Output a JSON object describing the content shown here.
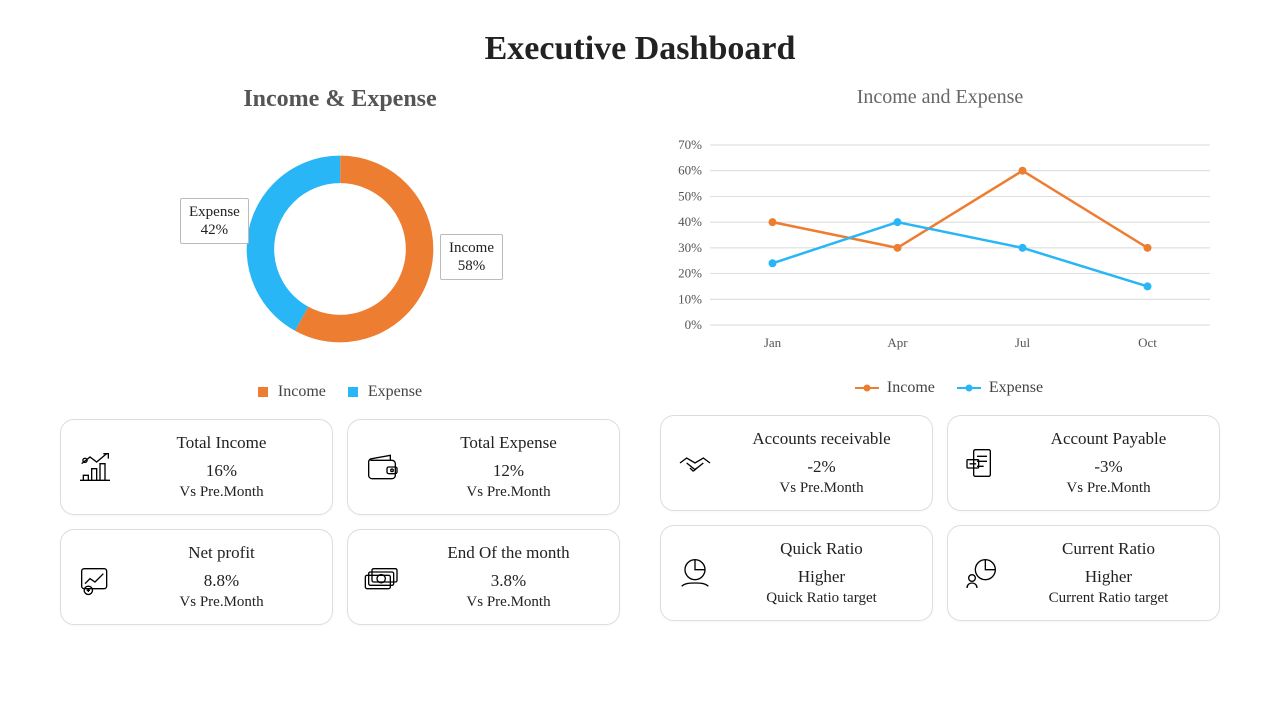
{
  "title": "Executive Dashboard",
  "colors": {
    "income": "#ED7D31",
    "expense": "#29B6F6"
  },
  "donut": {
    "title": "Income & Expense",
    "income_label_name": "Income",
    "income_label_pct": "58%",
    "expense_label_name": "Expense",
    "expense_label_pct": "42%",
    "legend_income": "Income",
    "legend_expense": "Expense"
  },
  "line": {
    "title": "Income and Expense",
    "legend_income": "Income",
    "legend_expense": "Expense"
  },
  "left_cards": [
    {
      "title": "Total Income",
      "value": "16%",
      "sub": "Vs Pre.Month",
      "icon": "money-growth"
    },
    {
      "title": "Total Expense",
      "value": "12%",
      "sub": "Vs Pre.Month",
      "icon": "wallet"
    },
    {
      "title": "Net profit",
      "value": "8.8%",
      "sub": "Vs Pre.Month",
      "icon": "profit-chart"
    },
    {
      "title": "End Of the month",
      "value": "3.8%",
      "sub": "Vs Pre.Month",
      "icon": "cash-stack"
    }
  ],
  "right_cards": [
    {
      "title": "Accounts receivable",
      "value": "-2%",
      "sub": "Vs Pre.Month",
      "icon": "handshake"
    },
    {
      "title": "Account Payable",
      "value": "-3%",
      "sub": "Vs Pre.Month",
      "icon": "receipt"
    },
    {
      "title": "Quick Ratio",
      "value": "Higher",
      "sub": "Quick Ratio target",
      "icon": "pie-hand"
    },
    {
      "title": "Current Ratio",
      "value": "Higher",
      "sub": "Current Ratio target",
      "icon": "pie-person"
    }
  ],
  "chart_data": [
    {
      "type": "pie",
      "title": "Income & Expense",
      "series": [
        {
          "name": "Income",
          "value": 58,
          "color": "#ED7D31"
        },
        {
          "name": "Expense",
          "value": 42,
          "color": "#29B6F6"
        }
      ]
    },
    {
      "type": "line",
      "title": "Income and Expense",
      "xlabel": "",
      "ylabel": "",
      "ylim": [
        0,
        70
      ],
      "y_suffix": "%",
      "categories": [
        "Jan",
        "Apr",
        "Jul",
        "Oct"
      ],
      "series": [
        {
          "name": "Income",
          "color": "#ED7D31",
          "values": [
            40,
            30,
            60,
            30
          ]
        },
        {
          "name": "Expense",
          "color": "#29B6F6",
          "values": [
            24,
            40,
            30,
            15
          ]
        }
      ]
    }
  ]
}
